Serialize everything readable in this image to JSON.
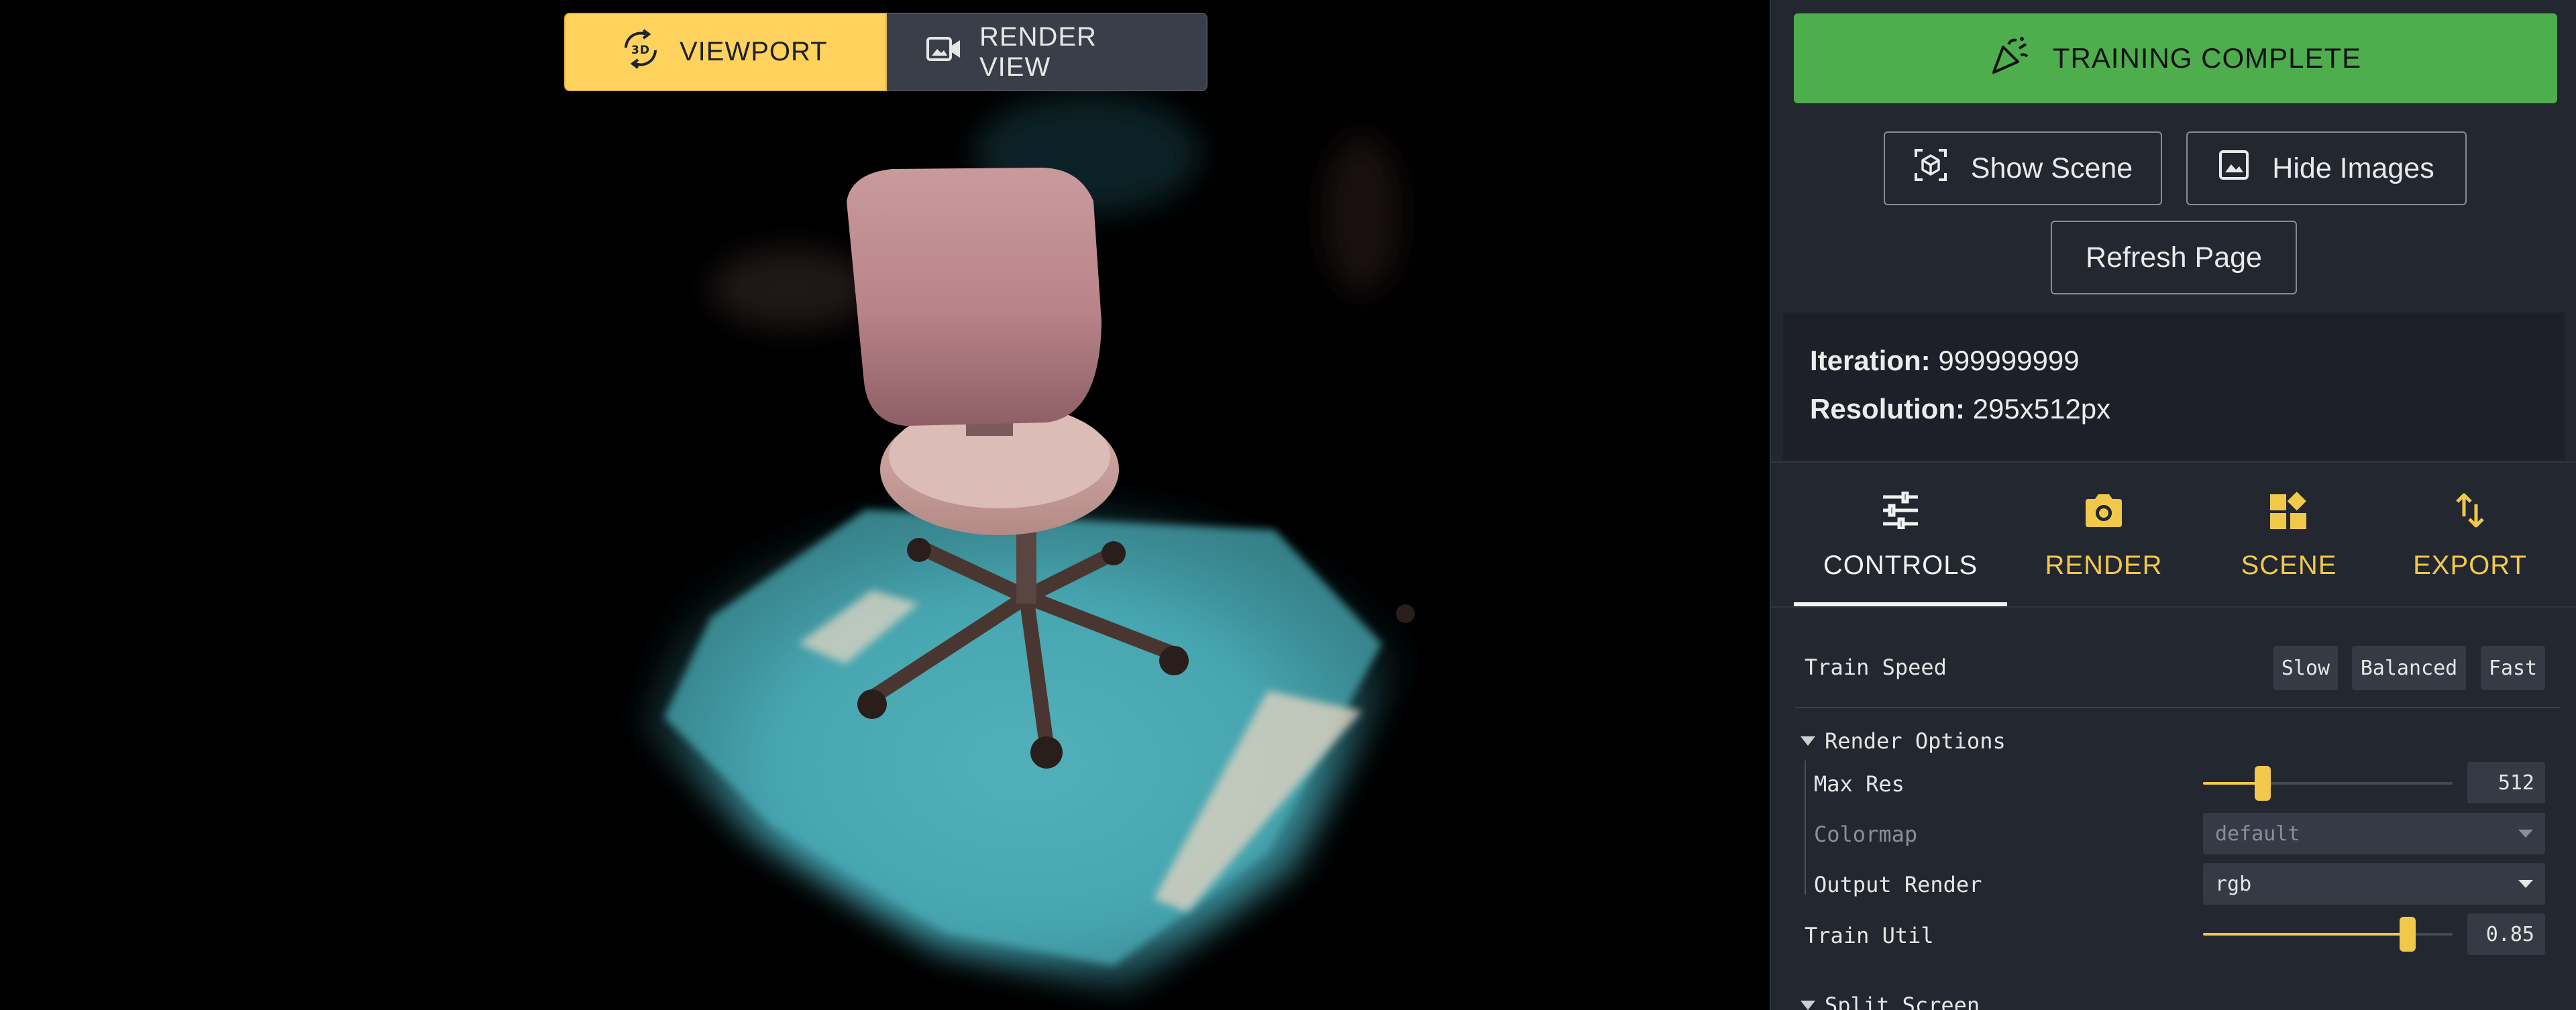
{
  "viewport": {
    "toggle": {
      "viewport_label": "VIEWPORT",
      "viewport_icon": "3d-rotation-icon",
      "render_view_label": "RENDER VIEW",
      "render_view_icon": "video-camera-icon",
      "active": "VIEWPORT"
    },
    "scene_content": "3D rendering of an office chair on a teal fur rug"
  },
  "sidebar": {
    "status_button": {
      "label": "TRAINING COMPLETE",
      "icon": "celebration-icon",
      "color": "#4eae4e"
    },
    "show_scene": {
      "label": "Show Scene",
      "icon": "cube-view-icon"
    },
    "hide_images": {
      "label": "Hide Images",
      "icon": "image-icon"
    },
    "refresh": {
      "label": "Refresh Page"
    },
    "info": {
      "iteration_label": "Iteration:",
      "iteration_value": "999999999",
      "resolution_label": "Resolution:",
      "resolution_value": "295x512px"
    },
    "tabs": [
      {
        "label": "CONTROLS",
        "icon": "sliders-icon",
        "active": true
      },
      {
        "label": "RENDER",
        "icon": "camera-icon",
        "active": false
      },
      {
        "label": "SCENE",
        "icon": "widgets-icon",
        "active": false
      },
      {
        "label": "EXPORT",
        "icon": "import-export-icon",
        "active": false
      }
    ],
    "controls": {
      "train_speed": {
        "label": "Train Speed",
        "options": [
          "Slow",
          "Balanced",
          "Fast"
        ]
      },
      "render_options": {
        "label": "Render Options",
        "max_res": {
          "label": "Max Res",
          "value": "512",
          "slider_fraction": 0.24
        },
        "colormap": {
          "label": "Colormap",
          "value": "default",
          "disabled": true
        },
        "output_render": {
          "label": "Output Render",
          "value": "rgb"
        }
      },
      "train_util": {
        "label": "Train Util",
        "value": "0.85",
        "slider_fraction": 0.82
      },
      "split_screen": {
        "label": "Split Screen"
      }
    },
    "accent_color": "#f2c84b"
  }
}
